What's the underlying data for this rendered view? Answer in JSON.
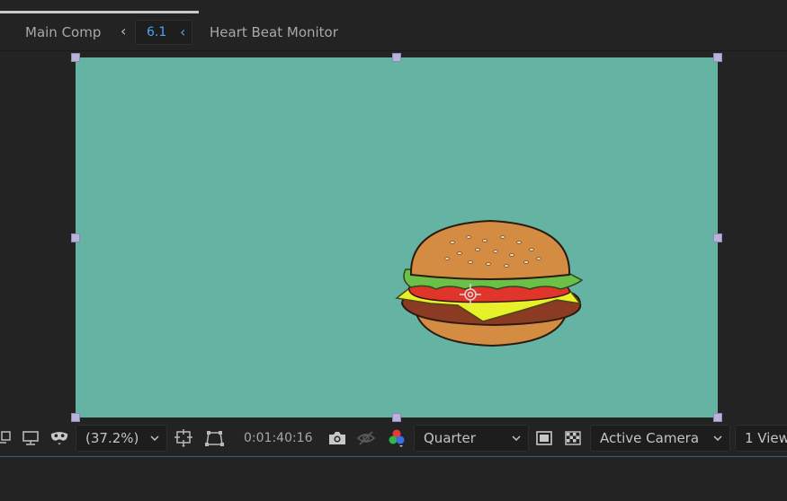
{
  "breadcrumb": {
    "main": "Main Comp",
    "current": "6.1",
    "child": "Heart Beat Monitor"
  },
  "icons": {
    "prev": "chevron-left-icon",
    "next": "chevron-left-icon"
  },
  "colors": {
    "canvas": "#64b3a3",
    "accent": "#4fa3f5",
    "handle": "#b8b3d9"
  },
  "toolbar": {
    "zoom": "(37.2%)",
    "timecode": "0:01:40:16",
    "resolution": "Quarter",
    "camera": "Active Camera",
    "views": "1 View"
  }
}
